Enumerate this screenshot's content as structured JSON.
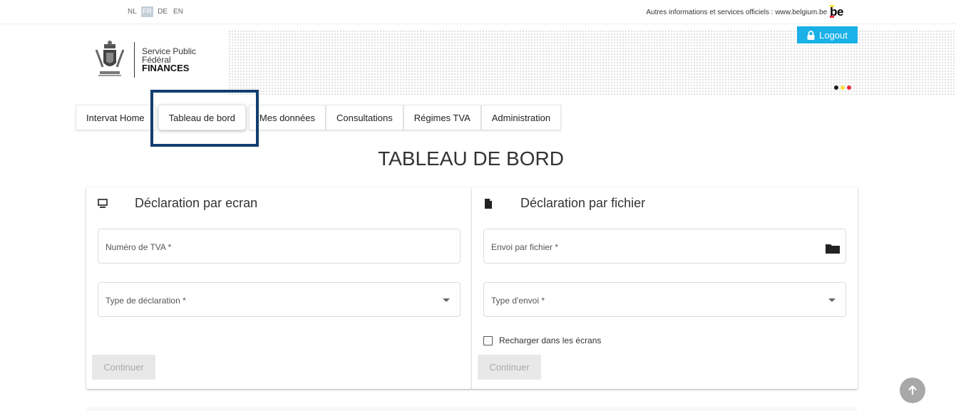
{
  "languages": [
    {
      "code": "NL",
      "active": false
    },
    {
      "code": "FR",
      "active": true
    },
    {
      "code": "DE",
      "active": false
    },
    {
      "code": "EN",
      "active": false
    }
  ],
  "official_info": "Autres informations et services officiels : www.belgium.be",
  "be_logo": "be",
  "brand": {
    "line1": "Service Public",
    "line2": "Fédéral",
    "line3": "FINANCES"
  },
  "logout_label": "Logout",
  "flag_colors": [
    "#1a1a1a",
    "#fae042",
    "#ed2939"
  ],
  "accent_color": "#1ab0e8",
  "highlight_color": "#123e6f",
  "tabs": [
    {
      "label": "Intervat Home",
      "active": false
    },
    {
      "label": "Tableau de bord",
      "active": true
    },
    {
      "label": "Mes données",
      "active": false
    },
    {
      "label": "Consultations",
      "active": false
    },
    {
      "label": "Régimes TVA",
      "active": false
    },
    {
      "label": "Administration",
      "active": false
    }
  ],
  "page_title": "TABLEAU DE BORD",
  "card_screen": {
    "title": "Déclaration par ecran",
    "icon": "monitor-icon",
    "vat_field_label": "Numéro de TVA *",
    "type_field_label": "Type de déclaration *",
    "continue_label": "Continuer"
  },
  "card_file": {
    "title": "Déclaration par fichier",
    "icon": "file-icon",
    "file_field_label": "Envoi par fichier *",
    "type_field_label": "Type d'envoi *",
    "reload_label": "Recharger dans les écrans",
    "continue_label": "Continuer"
  }
}
